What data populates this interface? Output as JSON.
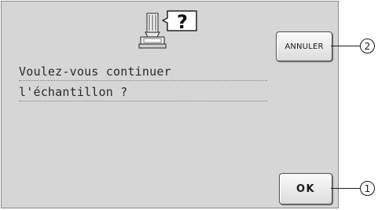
{
  "dialog": {
    "message_lines": [
      "Voulez-vous continuer",
      "l'échantillon ?"
    ],
    "icons": {
      "machine": "embroidery-machine-icon",
      "help": "question-mark-icon"
    },
    "help_symbol": "?"
  },
  "buttons": {
    "cancel_label": "ANNULER",
    "ok_label": "OK"
  },
  "callouts": {
    "cancel": "2",
    "ok": "1"
  }
}
